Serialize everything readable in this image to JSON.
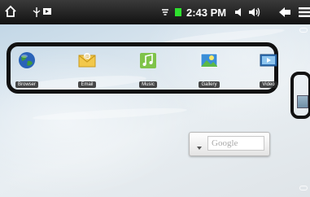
{
  "status_bar": {
    "time": "2:43 PM",
    "icons": [
      "home-icon",
      "usb-icon",
      "media-icon",
      "wifi-icon",
      "battery-icon",
      "volume-down-icon",
      "volume-up-icon",
      "back-icon",
      "menu-icon"
    ]
  },
  "apps": [
    {
      "label": "Browser",
      "icon": "globe-icon"
    },
    {
      "label": "Email",
      "icon": "email-icon"
    },
    {
      "label": "Music",
      "icon": "music-icon"
    },
    {
      "label": "Gallery",
      "icon": "gallery-icon"
    },
    {
      "label": "Video",
      "icon": "video-icon"
    }
  ],
  "google_widget": {
    "placeholder": "Google"
  },
  "colors": {
    "battery": "#2ee02e",
    "status_bg": "#1a1a1a",
    "tray_border": "#111111"
  }
}
